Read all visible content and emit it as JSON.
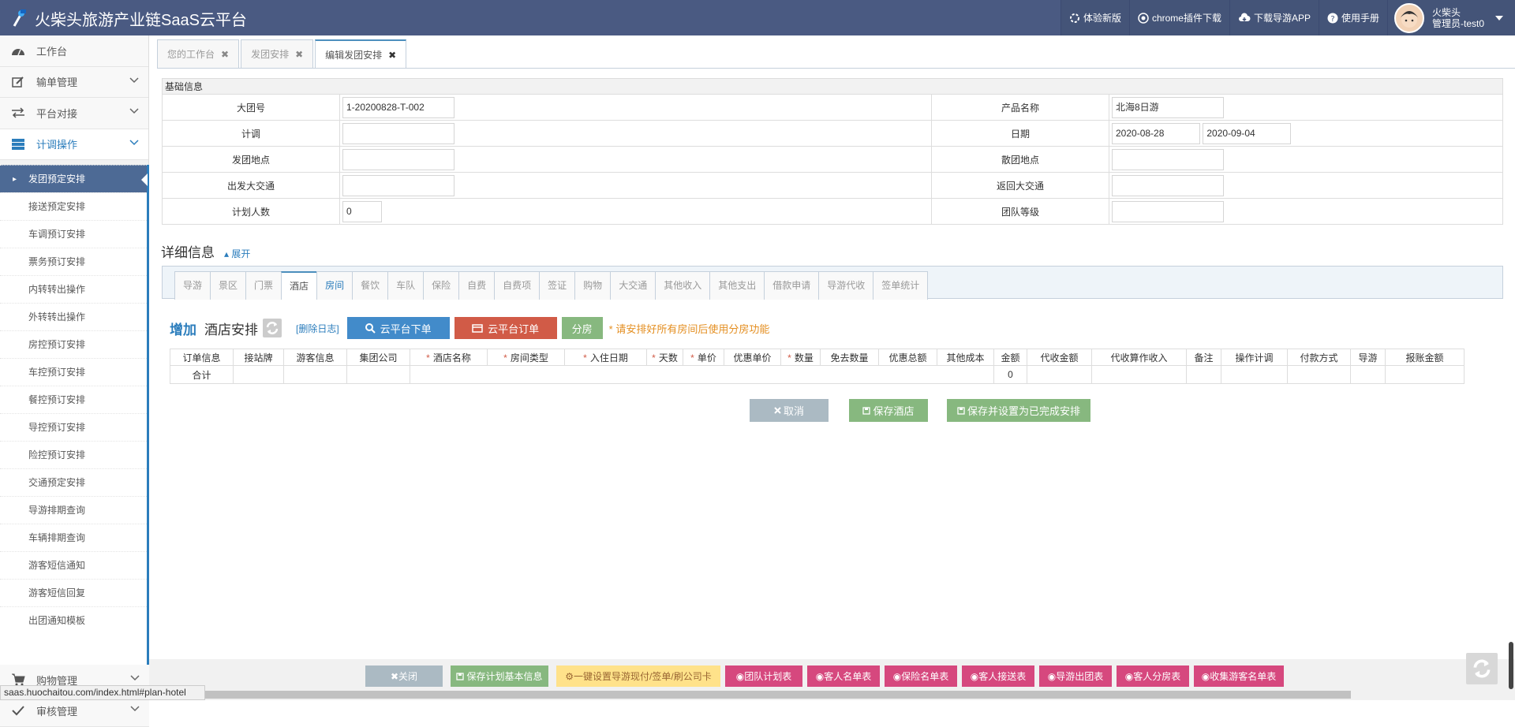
{
  "app": {
    "title": "火柴头旅游产业链SaaS云平台"
  },
  "header": {
    "nav": [
      "体验新版",
      "chrome插件下载",
      "下载导游APP",
      "使用手册"
    ],
    "user_name": "火柴头",
    "user_role": "管理员-test0"
  },
  "sidebar": {
    "menus": [
      {
        "label": "工作台",
        "icon": "dashboard-icon"
      },
      {
        "label": "输单管理",
        "icon": "edit-icon"
      },
      {
        "label": "平台对接",
        "icon": "exchange-icon"
      },
      {
        "label": "计调操作",
        "icon": "list-icon"
      }
    ],
    "sub": [
      "发团预定安排",
      "接送预定安排",
      "车调预订安排",
      "票务预订安排",
      "内转转出操作",
      "外转转出操作",
      "房控预订安排",
      "车控预订安排",
      "餐控预订安排",
      "导控预订安排",
      "险控预订安排",
      "交通预定安排",
      "导游排期查询",
      "车辆排期查询",
      "游客短信通知",
      "游客短信回复",
      "出团通知模板"
    ],
    "bottom_menus": [
      {
        "label": "购物管理",
        "icon": "cart-icon"
      },
      {
        "label": "审核管理",
        "icon": "check-icon"
      }
    ]
  },
  "tabs": [
    "您的工作台",
    "发团安排",
    "编辑发团安排"
  ],
  "basic": {
    "title": "基础信息",
    "rows": [
      {
        "l1": "大团号",
        "v1": "1-20200828-T-002",
        "l2": "产品名称",
        "v2": "北海8日游"
      },
      {
        "l1": "计调",
        "v1": "",
        "l2": "日期",
        "v2": "2020-08-28",
        "v3": "2020-09-04"
      },
      {
        "l1": "发团地点",
        "v1": "",
        "l2": "散团地点",
        "v2": ""
      },
      {
        "l1": "出发大交通",
        "v1": "",
        "l2": "返回大交通",
        "v2": ""
      },
      {
        "l1": "计划人数",
        "v1": "0",
        "l2": "团队等级",
        "v2": ""
      }
    ]
  },
  "detail": {
    "title": "详细信息",
    "expand": "展开"
  },
  "tabs2": [
    "导游",
    "景区",
    "门票",
    "酒店",
    "房间",
    "餐饮",
    "车队",
    "保险",
    "自费",
    "自费项",
    "签证",
    "购物",
    "大交通",
    "其他收入",
    "其他支出",
    "借款申请",
    "导游代收",
    "签单统计"
  ],
  "hotel": {
    "add": "增加",
    "title": "酒店安排",
    "del_log": "[删除日志]",
    "btn_order": "云平台下单",
    "btn_cloud": "云平台订单",
    "btn_room": "分房",
    "note": "* 请安排好所有房间后使用分房功能"
  },
  "grid": {
    "headers": [
      "订单信息",
      "接站牌",
      "游客信息",
      "集团公司",
      "酒店名称",
      "房间类型",
      "入住日期",
      "天数",
      "单价",
      "优惠单价",
      "数量",
      "免去数量",
      "优惠总额",
      "其他成本",
      "金额",
      "代收金额",
      "代收算作收入",
      "备注",
      "操作计调",
      "付款方式",
      "导游",
      "报账金额"
    ],
    "required": [
      4,
      5,
      6,
      7,
      8,
      10
    ],
    "total_label": "合计",
    "total_amount": "0"
  },
  "actions": {
    "cancel": "取消",
    "save": "保存酒店",
    "save_done": "保存并设置为已完成安排"
  },
  "bottom": [
    "关闭",
    "保存计划基本信息",
    "一键设置导游现付/签单/刷公司卡",
    "团队计划表",
    "客人名单表",
    "保险名单表",
    "客人接送表",
    "导游出团表",
    "客人分房表",
    "收集游客名单表"
  ],
  "status": "saas.huochaitou.com/index.html#plan-hotel"
}
